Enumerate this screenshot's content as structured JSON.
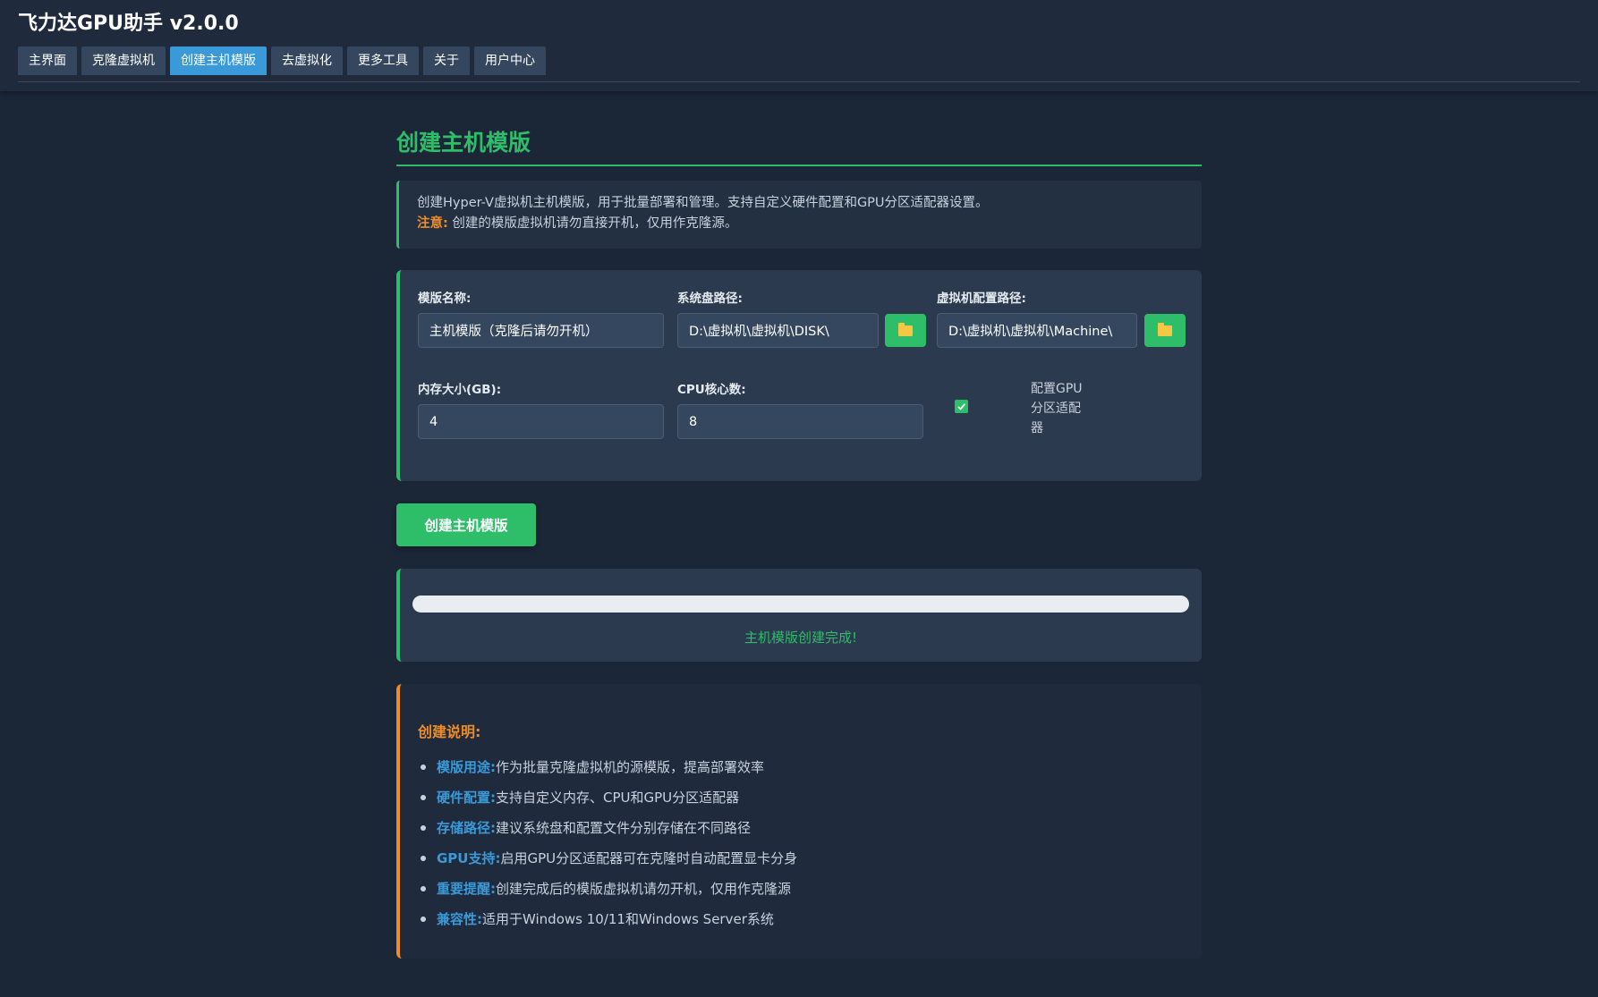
{
  "app": {
    "title": "飞力达GPU助手 v2.0.0"
  },
  "tabs": [
    {
      "label": "主界面"
    },
    {
      "label": "克隆虚拟机"
    },
    {
      "label": "创建主机模版",
      "active": true
    },
    {
      "label": "去虚拟化"
    },
    {
      "label": "更多工具"
    },
    {
      "label": "关于"
    },
    {
      "label": "用户中心"
    }
  ],
  "page": {
    "title": "创建主机模版",
    "intro": "创建Hyper-V虚拟机主机模版，用于批量部署和管理。支持自定义硬件配置和GPU分区适配器设置。",
    "warning_label": "注意:",
    "warning_text": " 创建的模版虚拟机请勿直接开机，仅用作克隆源。"
  },
  "form": {
    "template_name_label": "模版名称:",
    "template_name_value": "主机模版（克隆后请勿开机）",
    "system_disk_label": "系统盘路径:",
    "system_disk_value": "D:\\虚拟机\\虚拟机\\DISK\\",
    "config_path_label": "虚拟机配置路径:",
    "config_path_value": "D:\\虚拟机\\虚拟机\\Machine\\",
    "memory_label": "内存大小(GB):",
    "memory_value": "4",
    "cpu_label": "CPU核心数:",
    "cpu_value": "8",
    "gpu_checkbox_label": "配置GPU分区适配器",
    "gpu_checked": true
  },
  "actions": {
    "create_label": "创建主机模版"
  },
  "progress": {
    "value": 1.0,
    "status": "主机模版创建完成!"
  },
  "notes": {
    "title": "创建说明:",
    "items": [
      {
        "key": "模版用途:",
        "text": " 作为批量克隆虚拟机的源模版，提高部署效率"
      },
      {
        "key": "硬件配置:",
        "text": " 支持自定义内存、CPU和GPU分区适配器"
      },
      {
        "key": "存储路径:",
        "text": " 建议系统盘和配置文件分别存储在不同路径"
      },
      {
        "key": "GPU支持:",
        "text": " 启用GPU分区适配器可在克隆时自动配置显卡分身"
      },
      {
        "key": "重要提醒:",
        "text": " 创建完成后的模版虚拟机请勿开机，仅用作克隆源"
      },
      {
        "key": "兼容性:",
        "text": " 适用于Windows 10/11和Windows Server系统"
      }
    ]
  },
  "colors": {
    "accent_green": "#2ebd68",
    "accent_blue": "#3a9ad9",
    "accent_orange": "#f08c28",
    "background": "#1b2636"
  }
}
